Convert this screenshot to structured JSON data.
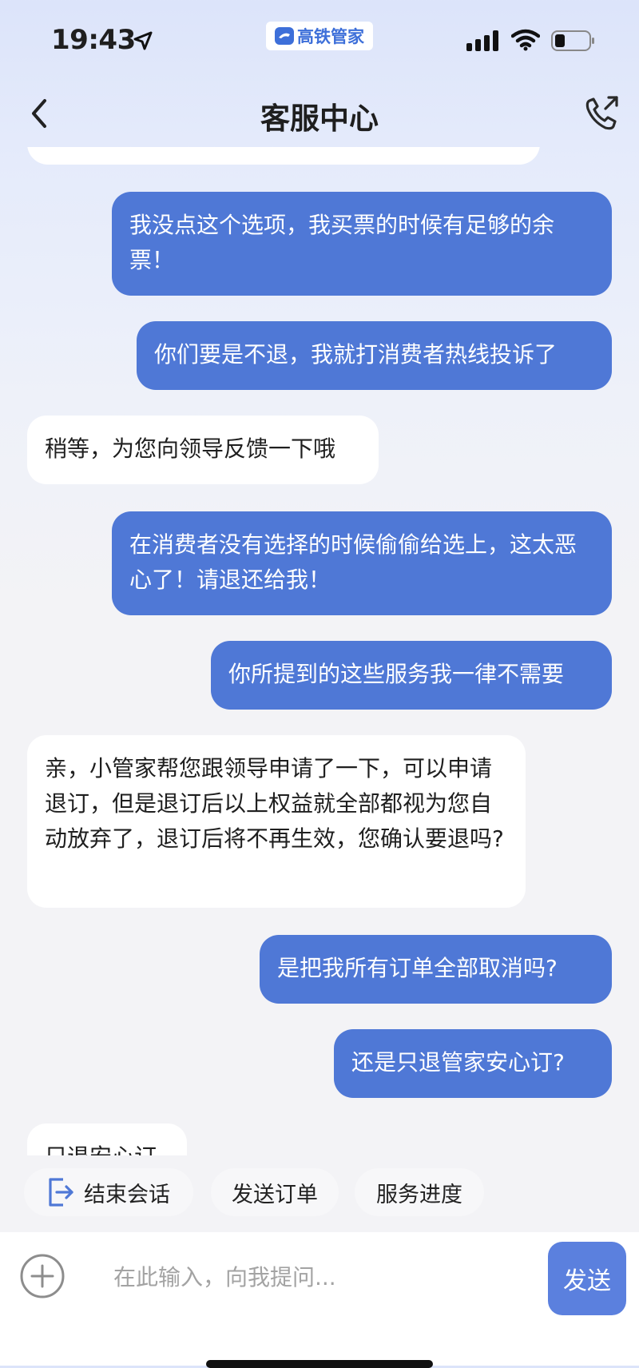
{
  "status_bar": {
    "time": "19:43",
    "app_badge": "高铁管家",
    "icons": [
      "location-arrow-icon",
      "signal-icon",
      "wifi-icon",
      "battery-icon"
    ]
  },
  "nav": {
    "title": "客服中心",
    "icons": [
      "back-chevron-icon",
      "phone-call-icon"
    ]
  },
  "messages": [
    {
      "from": "user",
      "text": "我没点这个选项，我买票的时候有足够的余票！"
    },
    {
      "from": "user",
      "text": "你们要是不退，我就打消费者热线投诉了"
    },
    {
      "from": "agent",
      "text": "稍等，为您向领导反馈一下哦"
    },
    {
      "from": "user",
      "text": "在消费者没有选择的时候偷偷给选上，这太恶心了！请退还给我！"
    },
    {
      "from": "user",
      "text": "你所提到的这些服务我一律不需要"
    },
    {
      "from": "agent",
      "text": "亲，小管家帮您跟领导申请了一下，可以申请退订，但是退订后以上权益就全部都视为您自动放弃了，退订后将不再生效，您确认要退吗?"
    },
    {
      "from": "user",
      "text": "是把我所有订单全部取消吗?"
    },
    {
      "from": "user",
      "text": "还是只退管家安心订?"
    },
    {
      "from": "agent",
      "text": "只退安心订"
    }
  ],
  "quick_actions": {
    "end_session": "结束会话",
    "send_order": "发送订单",
    "service_progress": "服务进度"
  },
  "input": {
    "placeholder": "在此输入，向我提问...",
    "send_label": "发送"
  },
  "colors": {
    "user_bubble": "#4f78d6",
    "send_button": "#5b80de",
    "brand": "#3d6fd9"
  }
}
